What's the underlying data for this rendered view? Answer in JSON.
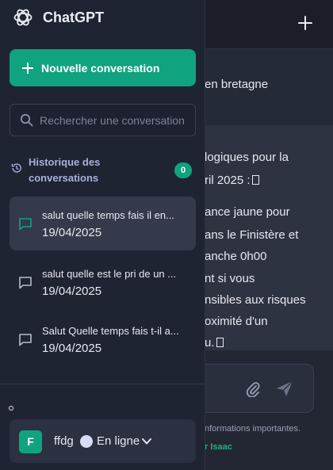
{
  "sidebar": {
    "app_name": "ChatGPT",
    "new_chat_label": "Nouvelle conversation",
    "search_placeholder": "Rechercher une conversation",
    "history_title": "Historique des conversations",
    "history_count": "0",
    "conversations": [
      {
        "title": "salut quelle temps fais il en...",
        "date": "19/04/2025",
        "active": true
      },
      {
        "title": "salut quelle est le pri de un ...",
        "date": "19/04/2025",
        "active": false
      },
      {
        "title": "Salut Quelle temps fais t-il a...",
        "date": "19/04/2025",
        "active": false
      }
    ],
    "user": {
      "initial": "F",
      "name": "ffdg",
      "status": "En ligne"
    }
  },
  "chat": {
    "user_message_fragment": "en bretagne",
    "bot_lines": [
      "logiques pour la",
      "ril 2025 :",
      "ance jaune pour",
      "ans le Finistère et",
      "anche 0h00",
      "nt si vous",
      "nsibles aux risques",
      "oximité d'un",
      "u."
    ],
    "disclaimer_fragment": "nformations importantes.",
    "credit_fragment": "r Isaac"
  },
  "colors": {
    "accent": "#10a37f",
    "sidebar_bg": "#1f2433",
    "active_item_bg": "#353a4a",
    "history_title": "#a8b0d6"
  },
  "icons": [
    "chatgpt-logo-icon",
    "plus-icon",
    "search-icon",
    "history-icon",
    "message-icon",
    "paperclip-icon",
    "send-icon",
    "chevron-down-icon"
  ]
}
